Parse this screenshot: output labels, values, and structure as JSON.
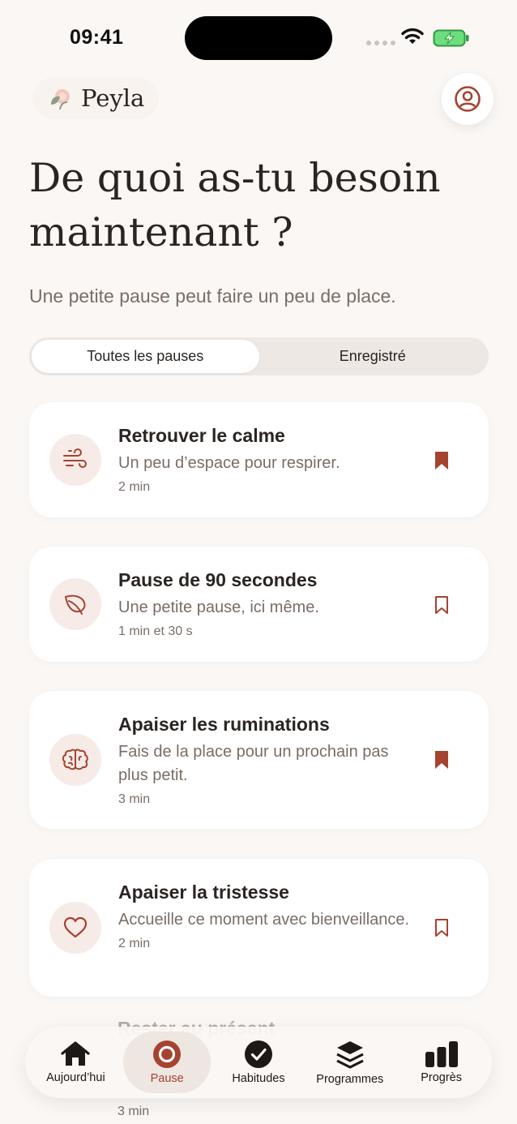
{
  "status_bar": {
    "time": "09:41"
  },
  "brand": {
    "name": "Peyla"
  },
  "header": {
    "title": "De quoi as-tu besoin maintenant ?",
    "subtitle": "Une petite pause peut faire un peu de place."
  },
  "segments": [
    {
      "label": "Toutes les pauses",
      "selected": true
    },
    {
      "label": "Enregistré",
      "selected": false
    }
  ],
  "cards": [
    {
      "title": "Retrouver le calme",
      "description": "Un peu d’espace pour respirer.",
      "duration": "2 min",
      "icon": "wind-icon",
      "saved": true
    },
    {
      "title": "Pause de 90 secondes",
      "description": "Une petite pause, ici même.",
      "duration": "1 min et 30 s",
      "icon": "leaf-icon",
      "saved": false
    },
    {
      "title": "Apaiser les ruminations",
      "description": "Fais de la place pour un prochain pas plus petit.",
      "duration": "3 min",
      "icon": "brain-icon",
      "saved": true
    },
    {
      "title": "Apaiser la tristesse",
      "description": "Accueille ce moment avec bienveillance.",
      "duration": "2 min",
      "icon": "heart-icon",
      "saved": false
    }
  ],
  "partial_card": {
    "title": "Rester au présent",
    "duration": "3 min"
  },
  "nav": [
    {
      "label": "Aujourd’hui",
      "icon": "home-icon",
      "active": false
    },
    {
      "label": "Pause",
      "icon": "pause-circle-icon",
      "active": true
    },
    {
      "label": "Habitudes",
      "icon": "check-circle-icon",
      "active": false
    },
    {
      "label": "Programmes",
      "icon": "layers-icon",
      "active": false
    },
    {
      "label": "Progrès",
      "icon": "bar-chart-icon",
      "active": false
    }
  ],
  "colors": {
    "accent": "#a64330",
    "background": "#faf7f4",
    "card": "#ffffff",
    "icon_bg": "#f6ebe7",
    "muted_text": "#7a6d66"
  }
}
